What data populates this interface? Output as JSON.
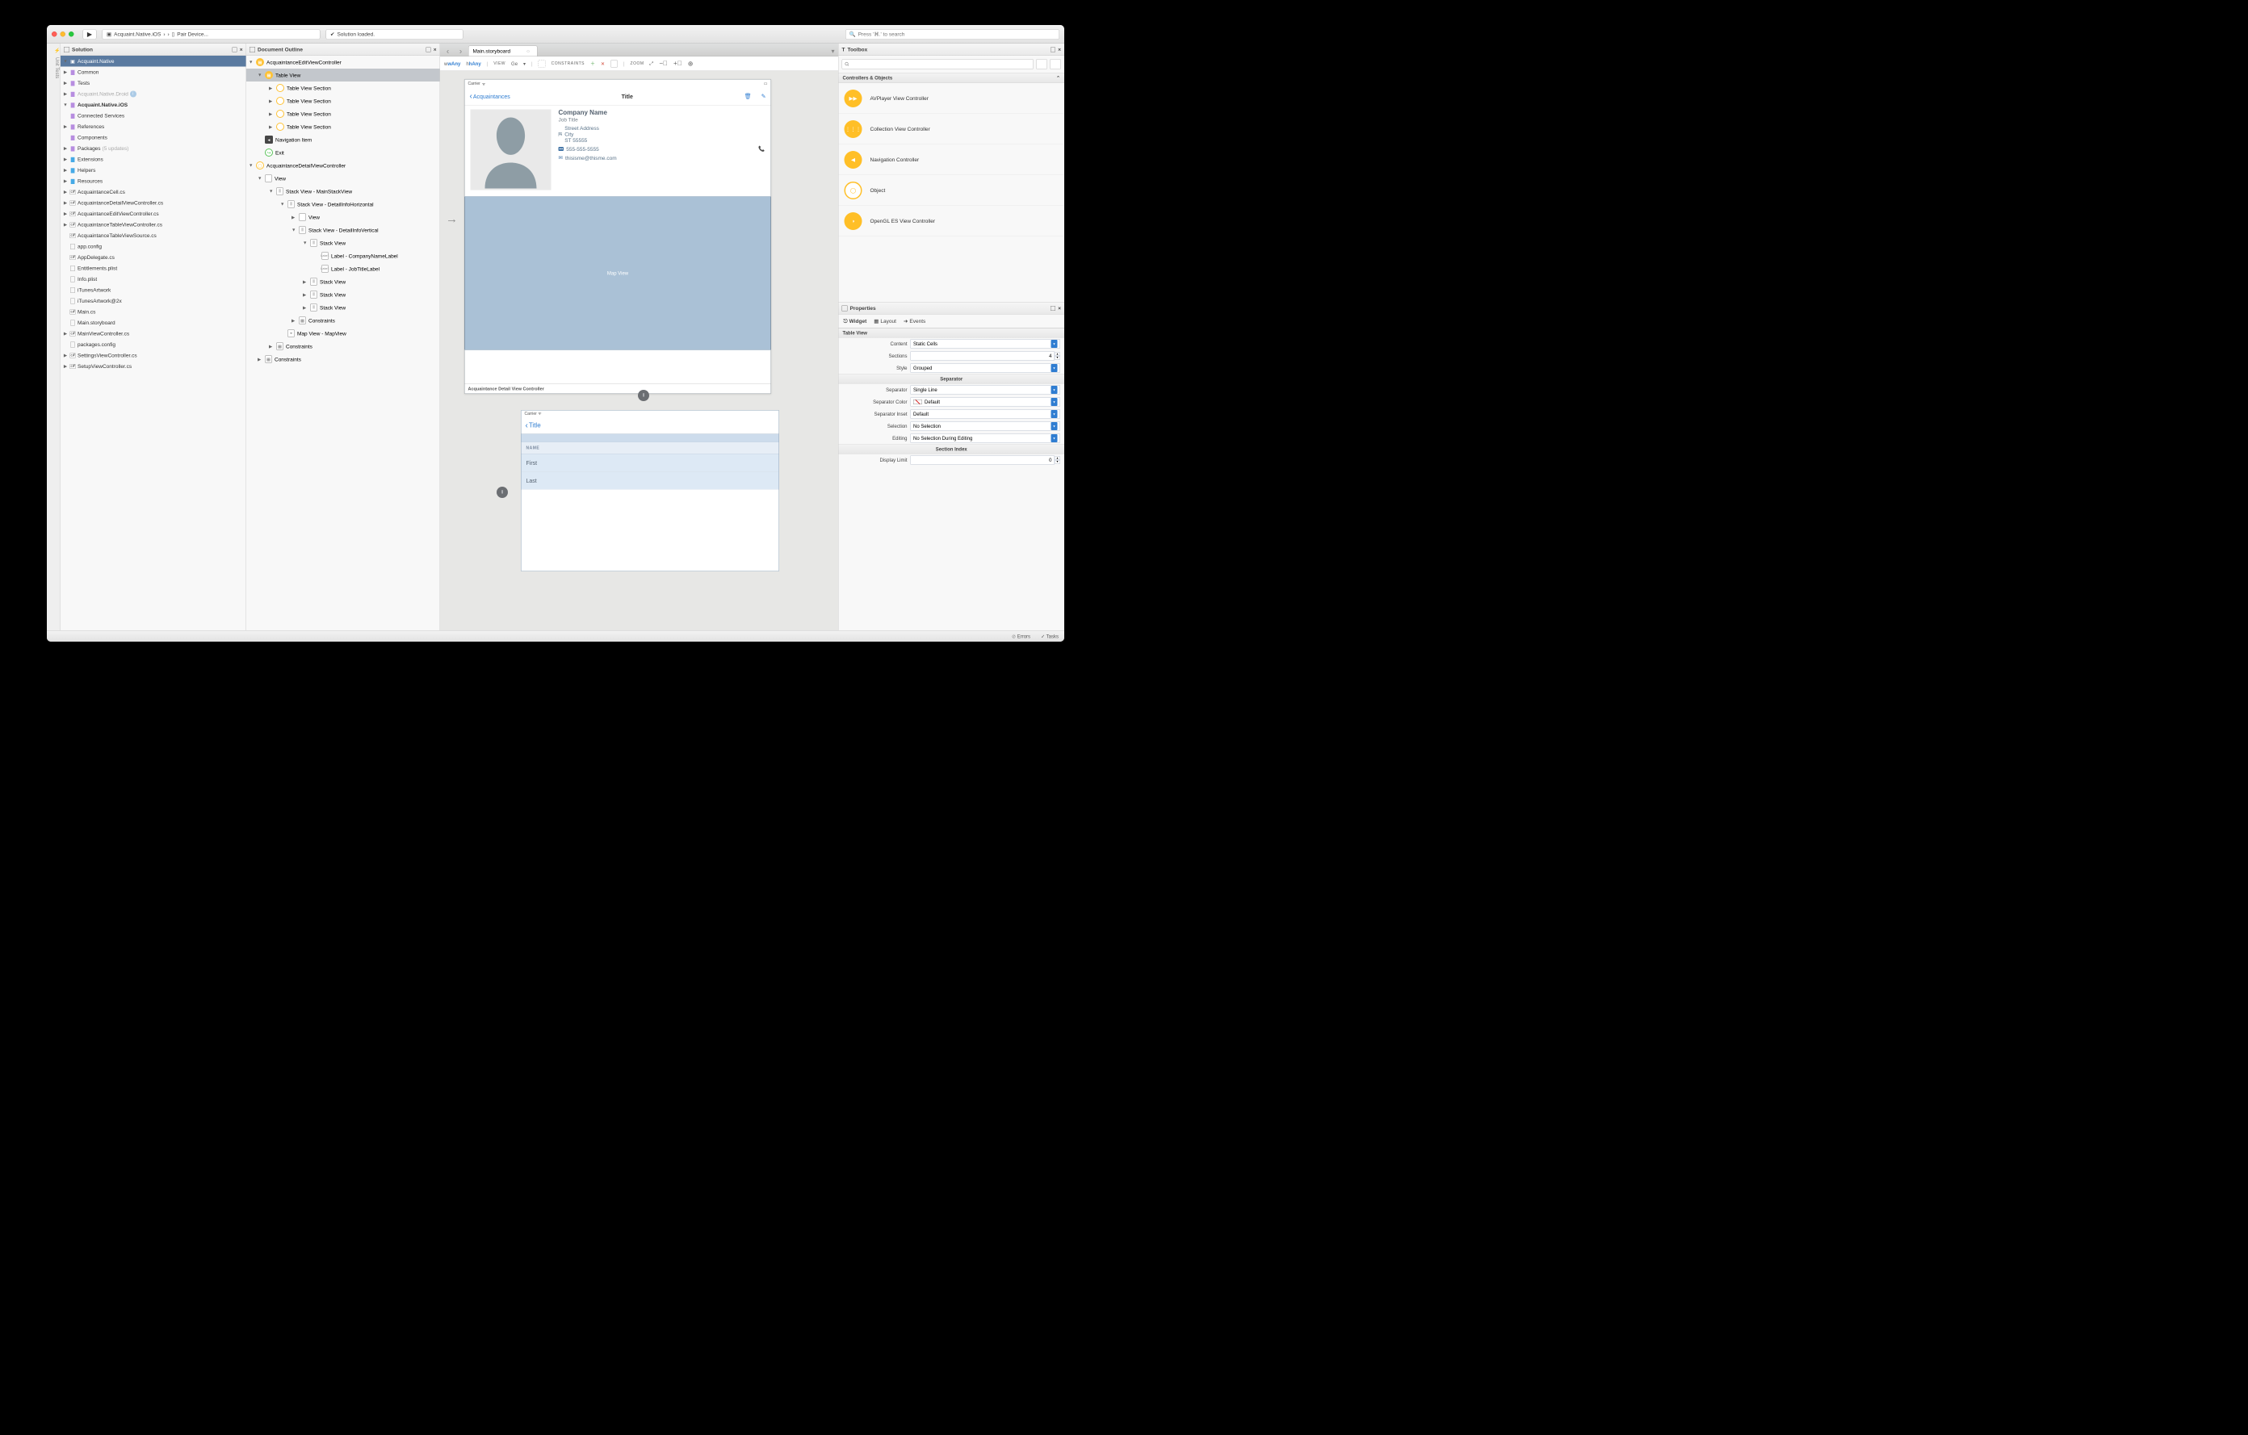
{
  "toolbar": {
    "breadcrumb_project": "Acquaint.Native.iOS",
    "breadcrumb_sep": "›",
    "breadcrumb_target": "Pair Device...",
    "status": "Solution loaded.",
    "search_placeholder": "Press '⌘.' to search"
  },
  "sidebar_tab": "Unit Tests",
  "solution": {
    "title": "Solution",
    "root": "Acquaint.Native",
    "items": [
      {
        "t": "Common",
        "depth": 1,
        "tw": "▶",
        "ico": "fold-p"
      },
      {
        "t": "Tests",
        "depth": 1,
        "tw": "▶",
        "ico": "fold-p"
      },
      {
        "t": "Acquaint.Native.Droid",
        "depth": 1,
        "tw": "▶",
        "ico": "fold-p",
        "muted": true,
        "info": true
      },
      {
        "t": "Acquaint.Native.iOS",
        "depth": 1,
        "tw": "▼",
        "ico": "fold-p",
        "bold": true
      },
      {
        "t": "Connected Services",
        "depth": 2,
        "tw": "",
        "ico": "fold-p"
      },
      {
        "t": "References",
        "depth": 2,
        "tw": "▶",
        "ico": "fold-p"
      },
      {
        "t": "Components",
        "depth": 2,
        "tw": "",
        "ico": "fold-p"
      },
      {
        "t": "Packages",
        "depth": 2,
        "tw": "▶",
        "ico": "fold-p",
        "suffix": "(5 updates)"
      },
      {
        "t": "Extensions",
        "depth": 2,
        "tw": "▶",
        "ico": "fold-b"
      },
      {
        "t": "Helpers",
        "depth": 2,
        "tw": "▶",
        "ico": "fold-b"
      },
      {
        "t": "Resources",
        "depth": 2,
        "tw": "▶",
        "ico": "fold-b"
      },
      {
        "t": "AcquaintanceCell.cs",
        "depth": 2,
        "tw": "▶",
        "ico": "cs"
      },
      {
        "t": "AcquaintanceDetailViewController.cs",
        "depth": 2,
        "tw": "▶",
        "ico": "cs"
      },
      {
        "t": "AcquaintanceEditViewController.cs",
        "depth": 2,
        "tw": "▶",
        "ico": "cs"
      },
      {
        "t": "AcquaintanceTableViewController.cs",
        "depth": 2,
        "tw": "▶",
        "ico": "cs"
      },
      {
        "t": "AcquaintanceTableViewSource.cs",
        "depth": 2,
        "tw": "",
        "ico": "cs"
      },
      {
        "t": "app.config",
        "depth": 2,
        "tw": "",
        "ico": "file"
      },
      {
        "t": "AppDelegate.cs",
        "depth": 2,
        "tw": "",
        "ico": "cs"
      },
      {
        "t": "Entitlements.plist",
        "depth": 2,
        "tw": "",
        "ico": "file"
      },
      {
        "t": "Info.plist",
        "depth": 2,
        "tw": "",
        "ico": "file"
      },
      {
        "t": "iTunesArtwork",
        "depth": 2,
        "tw": "",
        "ico": "file"
      },
      {
        "t": "iTunesArtwork@2x",
        "depth": 2,
        "tw": "",
        "ico": "file"
      },
      {
        "t": "Main.cs",
        "depth": 2,
        "tw": "",
        "ico": "cs"
      },
      {
        "t": "Main.storyboard",
        "depth": 2,
        "tw": "",
        "ico": "file"
      },
      {
        "t": "MainViewController.cs",
        "depth": 2,
        "tw": "▶",
        "ico": "cs"
      },
      {
        "t": "packages.config",
        "depth": 2,
        "tw": "",
        "ico": "file"
      },
      {
        "t": "SettingsViewController.cs",
        "depth": 2,
        "tw": "▶",
        "ico": "cs"
      },
      {
        "t": "SetupViewController.cs",
        "depth": 2,
        "tw": "▶",
        "ico": "cs"
      }
    ]
  },
  "outline": {
    "title": "Document Outline",
    "rows": [
      {
        "lv": 0,
        "tw": "▼",
        "ico": "oy",
        "label": "AcquaintanceEditViewController"
      },
      {
        "lv": 1,
        "tw": "▼",
        "ico": "oy",
        "label": "Table View",
        "sel": true
      },
      {
        "lv": 2,
        "tw": "▶",
        "ico": "or",
        "label": "Table View Section"
      },
      {
        "lv": 2,
        "tw": "▶",
        "ico": "or",
        "label": "Table View Section"
      },
      {
        "lv": 2,
        "tw": "▶",
        "ico": "or",
        "label": "Table View Section"
      },
      {
        "lv": 2,
        "tw": "▶",
        "ico": "or",
        "label": "Table View Section"
      },
      {
        "lv": 1,
        "tw": "",
        "ico": "dk",
        "label": "Navigation Item"
      },
      {
        "lv": 1,
        "tw": "",
        "ico": "gr",
        "label": "Exit",
        "glyph": "↪"
      },
      {
        "lv": 0,
        "tw": "▼",
        "ico": "oy-outline",
        "label": "AcquaintanceDetailViewController"
      },
      {
        "lv": 1,
        "tw": "▼",
        "ico": "bx",
        "label": "View"
      },
      {
        "lv": 2,
        "tw": "▼",
        "ico": "bx",
        "label": "Stack View - MainStackView",
        "glyph": "⫴"
      },
      {
        "lv": 3,
        "tw": "▼",
        "ico": "bx",
        "label": "Stack View - DetailInfoHorizontal",
        "glyph": "⫴"
      },
      {
        "lv": 4,
        "tw": "▶",
        "ico": "bx",
        "label": "View"
      },
      {
        "lv": 4,
        "tw": "▼",
        "ico": "bx",
        "label": "Stack View - DetailInfoVertical",
        "glyph": "⫴"
      },
      {
        "lv": 5,
        "tw": "▼",
        "ico": "bx",
        "label": "Stack View",
        "glyph": "⫴"
      },
      {
        "lv": 6,
        "tw": "",
        "ico": "lbl",
        "label": "Label - CompanyNameLabel"
      },
      {
        "lv": 6,
        "tw": "",
        "ico": "lbl",
        "label": "Label - JobTitleLabel"
      },
      {
        "lv": 5,
        "tw": "▶",
        "ico": "bx",
        "label": "Stack View",
        "glyph": "⫴"
      },
      {
        "lv": 5,
        "tw": "▶",
        "ico": "bx",
        "label": "Stack View",
        "glyph": "⫴"
      },
      {
        "lv": 5,
        "tw": "▶",
        "ico": "bx",
        "label": "Stack View",
        "glyph": "⫴"
      },
      {
        "lv": 4,
        "tw": "▶",
        "ico": "bx",
        "label": "Constraints",
        "glyph": "▦"
      },
      {
        "lv": 3,
        "tw": "",
        "ico": "bx",
        "label": "Map View - MapView",
        "glyph": "⌖"
      },
      {
        "lv": 2,
        "tw": "▶",
        "ico": "bx",
        "label": "Constraints",
        "glyph": "▦"
      },
      {
        "lv": 1,
        "tw": "▶",
        "ico": "bx",
        "label": "Constraints",
        "glyph": "▦"
      }
    ]
  },
  "center": {
    "tab_label": "Main.storyboard",
    "wany": "wAny",
    "hany": "hAny",
    "view_label": "VIEW",
    "view_value": "Ge",
    "constraints_label": "CONSTRAINTS",
    "zoom_label": "ZOOM",
    "device1": {
      "carrier": "Carrier",
      "back": "Acquaintances",
      "title": "Title",
      "company": "Company Name",
      "job": "Job Title",
      "street": "Street Address",
      "city": "City",
      "st": "ST 55555",
      "phone": "555-555-5555",
      "email": "thisisme@thisme.com",
      "map_label": "Map View",
      "caption": "Acquaintance Detail View Controller"
    },
    "device2": {
      "carrier": "Carrier",
      "back": "Title",
      "name_hdr": "NAME",
      "first": "First",
      "last": "Last"
    }
  },
  "toolbox": {
    "title": "Toolbox",
    "section": "Controllers & Objects",
    "items": [
      "AVPlayer View Controller",
      "Collection View Controller",
      "Navigation Controller",
      "Object",
      "OpenGL ES View Controller"
    ]
  },
  "props": {
    "title": "Properties",
    "tabs": {
      "widget": "Widget",
      "layout": "Layout",
      "events": "Events"
    },
    "section_main": "Table View",
    "content_label": "Content",
    "content_value": "Static Cells",
    "sections_label": "Sections",
    "sections_value": "4",
    "style_label": "Style",
    "style_value": "Grouped",
    "sep_title": "Separator",
    "sep_label": "Separator",
    "sep_value": "Single Line",
    "sepcolor_label": "Separator Color",
    "sepcolor_value": "Default",
    "sepinset_label": "Separator Inset",
    "sepinset_value": "Default",
    "selection_label": "Selection",
    "selection_value": "No Selection",
    "editing_label": "Editing",
    "editing_value": "No Selection During Editing",
    "sidx_title": "Section Index",
    "display_limit_label": "Display Limit",
    "display_limit_value": "0"
  },
  "status": {
    "errors": "Errors",
    "tasks": "Tasks"
  }
}
